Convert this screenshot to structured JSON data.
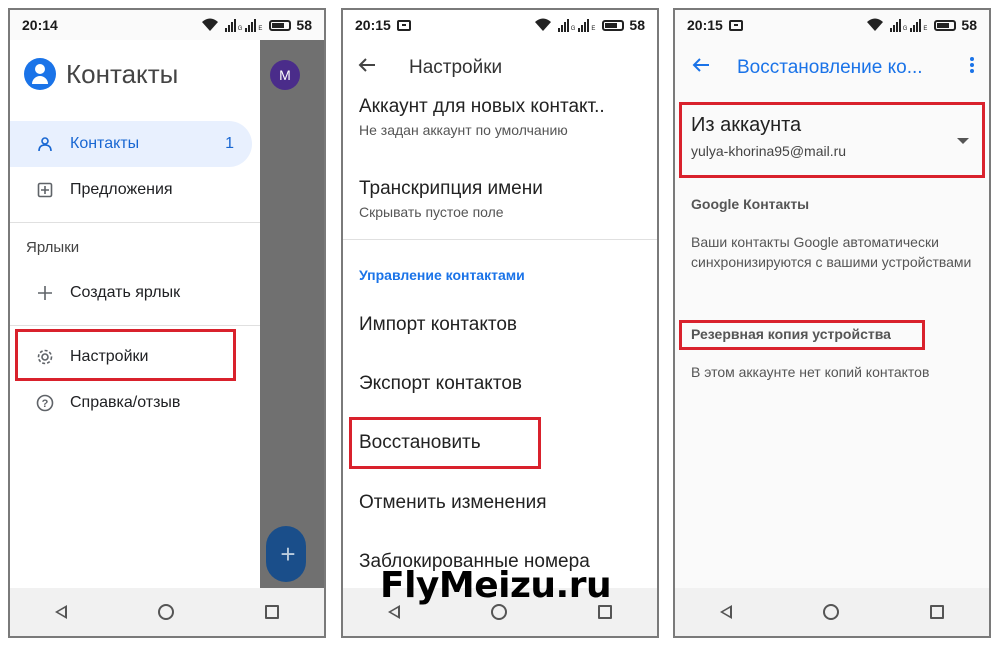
{
  "status_bars": [
    {
      "time": "20:14",
      "network_label": "E",
      "battery": "58"
    },
    {
      "time": "20:15",
      "network_label": "E",
      "battery": "58"
    },
    {
      "time": "20:15",
      "network_label": "E",
      "battery": "58"
    }
  ],
  "screen1": {
    "app_title": "Контакты",
    "avatar_letter": "M",
    "fab_icon": "+",
    "items": {
      "contacts": {
        "label": "Контакты",
        "count": "1",
        "icon": "person-icon"
      },
      "suggestions": {
        "label": "Предложения",
        "icon": "suggestions-icon"
      },
      "labels_header": "Ярлыки",
      "create_label": {
        "label": "Создать ярлык",
        "icon": "plus-icon"
      },
      "settings": {
        "label": "Настройки",
        "icon": "gear-icon"
      },
      "help": {
        "label": "Справка/отзыв",
        "icon": "help-icon"
      }
    }
  },
  "screen2": {
    "title": "Настройки",
    "account": {
      "title": "Аккаунт для новых контакт..",
      "subtitle": "Не задан аккаунт по умолчанию"
    },
    "transcription": {
      "title": "Транскрипция имени",
      "subtitle": "Скрывать пустое поле"
    },
    "section_title": "Управление контактами",
    "import": "Импорт контактов",
    "export": "Экспорт контактов",
    "restore": "Восстановить",
    "undo": "Отменить изменения",
    "blocked": "Заблокированные номера"
  },
  "screen3": {
    "title": "Восстановление ко...",
    "account_label": "Из аккаунта",
    "account_email": "yulya-khorina95@mail.ru",
    "google_header": "Google Контакты",
    "google_text": "Ваши контакты Google автоматически синхронизируются с вашими устройствами",
    "backup_header": "Резервная копия устройства",
    "backup_text": "В этом аккаунте нет копий контактов"
  },
  "watermark": "FlyMeizu.ru",
  "colors": {
    "highlight_box": "#d9212c",
    "accent_blue": "#1a73e8",
    "active_bg": "#e8f0fe"
  }
}
